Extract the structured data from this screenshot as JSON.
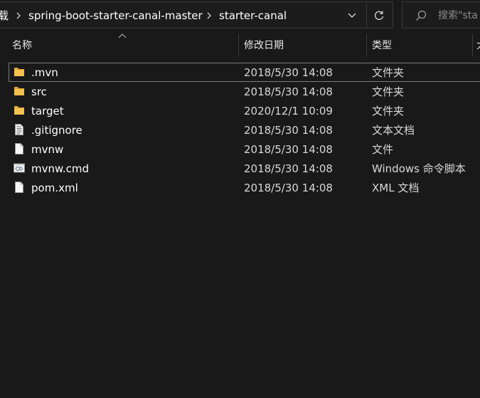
{
  "address_bar": {
    "breadcrumbs": [
      {
        "label": "载"
      },
      {
        "label": "spring-boot-starter-canal-master"
      },
      {
        "label": "starter-canal"
      }
    ],
    "dropdown_icon": "chevron-down-icon",
    "refresh_icon": "refresh-icon"
  },
  "search": {
    "placeholder": "搜索\"sta",
    "icon": "search-icon"
  },
  "columns": {
    "name": "名称",
    "modified": "修改日期",
    "type": "类型",
    "size": "大"
  },
  "files": [
    {
      "name": ".mvn",
      "modified": "2018/5/30 14:08",
      "type": "文件夹",
      "icon": "folder-icon"
    },
    {
      "name": "src",
      "modified": "2018/5/30 14:08",
      "type": "文件夹",
      "icon": "folder-icon"
    },
    {
      "name": "target",
      "modified": "2020/12/1 10:09",
      "type": "文件夹",
      "icon": "folder-icon"
    },
    {
      "name": ".gitignore",
      "modified": "2018/5/30 14:08",
      "type": "文本文档",
      "icon": "text-document-icon"
    },
    {
      "name": "mvnw",
      "modified": "2018/5/30 14:08",
      "type": "文件",
      "icon": "blank-file-icon"
    },
    {
      "name": "mvnw.cmd",
      "modified": "2018/5/30 14:08",
      "type": "Windows 命令脚本",
      "icon": "command-script-icon"
    },
    {
      "name": "pom.xml",
      "modified": "2018/5/30 14:08",
      "type": "XML 文档",
      "icon": "blank-file-icon"
    }
  ],
  "colors": {
    "background": "#191919",
    "folder": "#f2c14e",
    "border": "#3a3a3a"
  }
}
